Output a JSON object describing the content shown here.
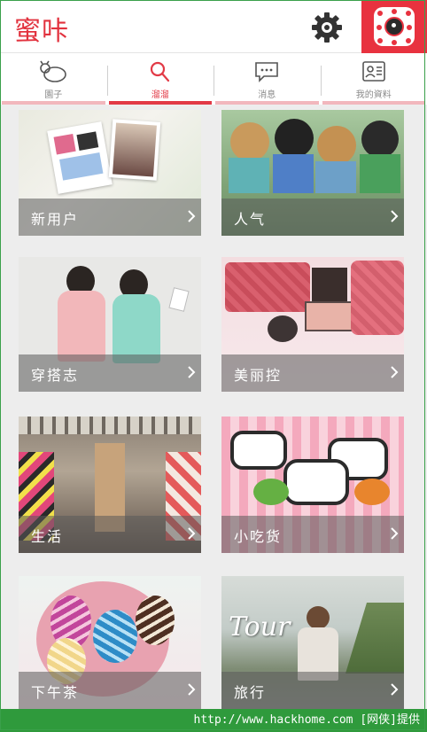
{
  "header": {
    "logo_text": "蜜咔",
    "icons": {
      "settings": "gear-icon",
      "camera": "camera-icon"
    },
    "accent": "#e2323e"
  },
  "tabs": [
    {
      "label": "園子",
      "icon": "garden-icon",
      "active": false
    },
    {
      "label": "溜溜",
      "icon": "search-icon",
      "active": true
    },
    {
      "label": "消息",
      "icon": "message-icon",
      "active": false
    },
    {
      "label": "我的資料",
      "icon": "profile-card-icon",
      "active": false
    }
  ],
  "categories": [
    {
      "label": "新用户",
      "icon": "chevron-right-icon"
    },
    {
      "label": "人气",
      "icon": "chevron-right-icon"
    },
    {
      "label": "穿搭志",
      "icon": "chevron-right-icon"
    },
    {
      "label": "美丽控",
      "icon": "chevron-right-icon"
    },
    {
      "label": "生活",
      "icon": "chevron-right-icon"
    },
    {
      "label": "小吃货",
      "icon": "chevron-right-icon"
    },
    {
      "label": "下午茶",
      "icon": "chevron-right-icon"
    },
    {
      "label": "旅行",
      "icon": "chevron-right-icon"
    }
  ],
  "photo_texts": {
    "tour": "Tour"
  },
  "watermark": "http://www.hackhome.com [网侠]提供",
  "colors": {
    "watermark_bg": "#2f9a3c",
    "caption_overlay": "rgba(90,90,90,0.55)"
  }
}
